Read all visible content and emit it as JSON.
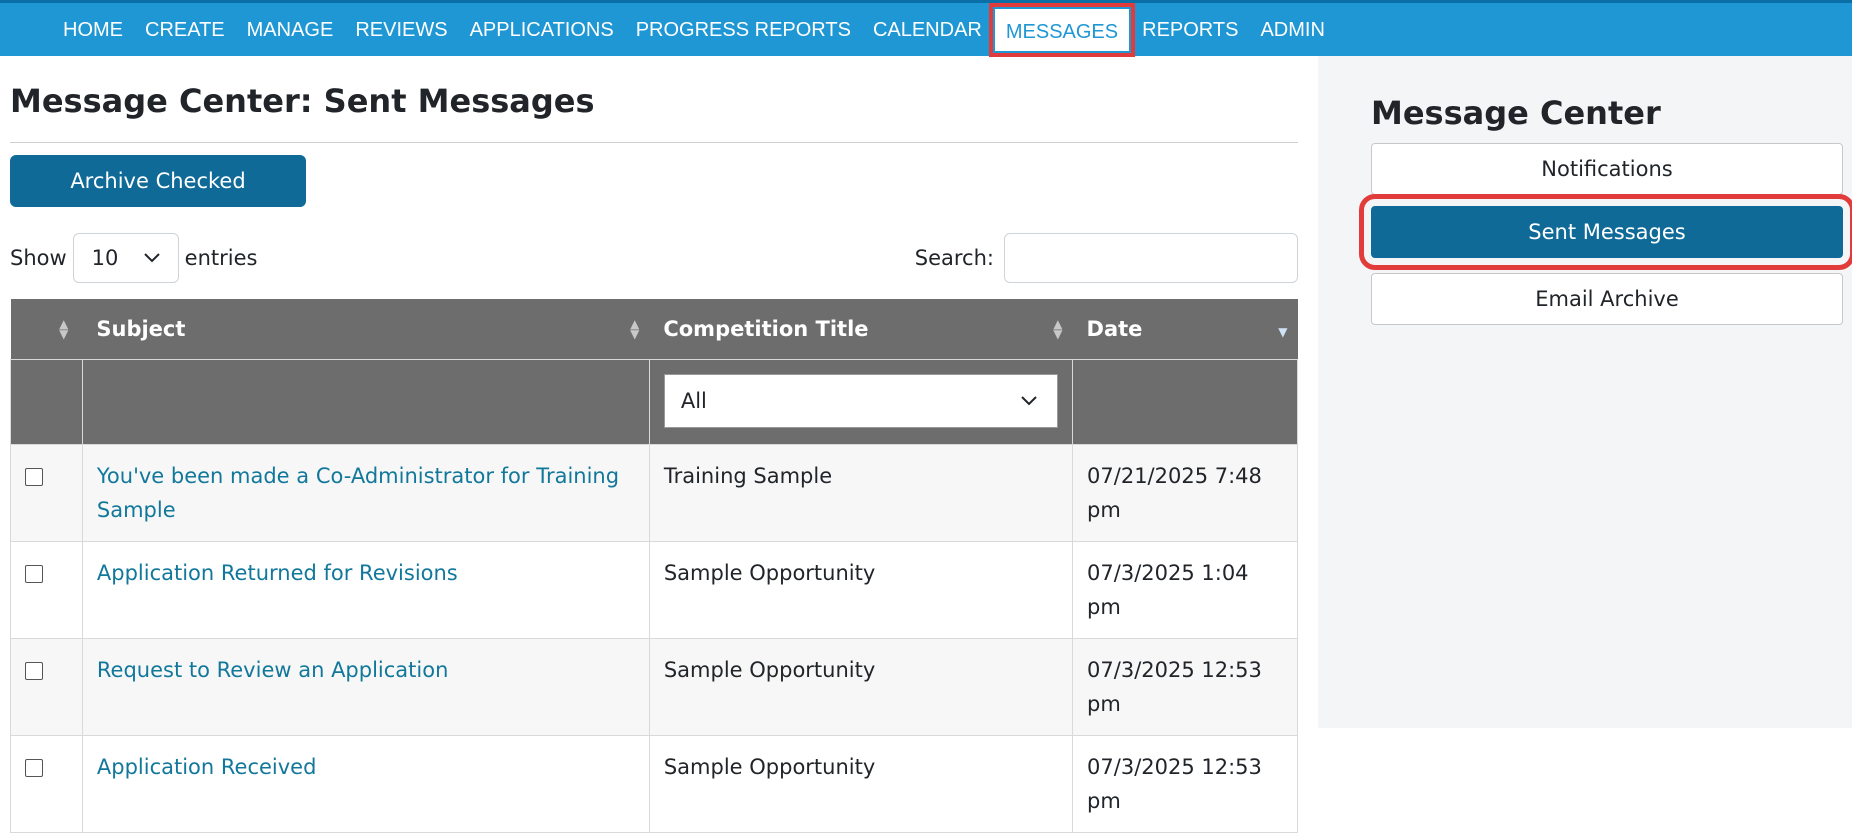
{
  "nav": {
    "items": [
      "HOME",
      "CREATE",
      "MANAGE",
      "REVIEWS",
      "APPLICATIONS",
      "PROGRESS REPORTS",
      "CALENDAR",
      "MESSAGES",
      "REPORTS",
      "ADMIN"
    ],
    "active": "MESSAGES"
  },
  "page": {
    "title": "Message Center: Sent Messages",
    "archive_button": "Archive Checked",
    "show_label": "Show",
    "show_value": "10",
    "entries_label": "entries",
    "search_label": "Search:",
    "search_value": ""
  },
  "table": {
    "headers": {
      "subject": "Subject",
      "competition": "Competition Title",
      "date": "Date"
    },
    "competition_filter": "All",
    "rows": [
      {
        "subject": "You've been made a Co-Administrator for Training Sample",
        "competition": "Training Sample",
        "date": "07/21/2025 7:48 pm"
      },
      {
        "subject": "Application Returned for Revisions",
        "competition": "Sample Opportunity",
        "date": "07/3/2025 1:04 pm"
      },
      {
        "subject": "Request to Review an Application",
        "competition": "Sample Opportunity",
        "date": "07/3/2025 12:53 pm"
      },
      {
        "subject": "Application Received",
        "competition": "Sample Opportunity",
        "date": "07/3/2025 12:53 pm"
      }
    ]
  },
  "sidebar": {
    "title": "Message Center",
    "buttons": [
      "Notifications",
      "Sent Messages",
      "Email Archive"
    ],
    "active": "Sent Messages"
  },
  "colors": {
    "topbar": "#1f97d4",
    "primary_button": "#0f6a98",
    "link": "#12789b",
    "highlight": "#e23b3b",
    "table_header": "#6d6d6d"
  }
}
